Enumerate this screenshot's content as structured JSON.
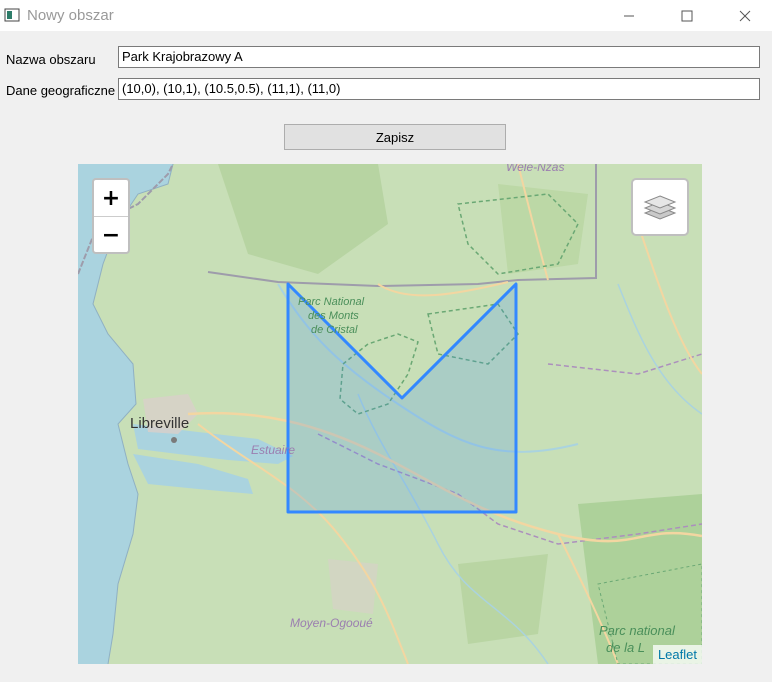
{
  "window": {
    "title": "Nowy obszar",
    "minimize_icon": "minimize-icon",
    "maximize_icon": "maximize-icon",
    "close_icon": "close-icon"
  },
  "form": {
    "name_label": "Nazwa obszaru",
    "name_value": "Park Krajobrazowy A",
    "geo_label": "Dane geograficzne",
    "geo_value": "(10,0), (10,1), (10.5,0.5), (11,1), (11,0)",
    "save_label": "Zapisz"
  },
  "map": {
    "zoom_in": "+",
    "zoom_out": "−",
    "layers_icon": "layers-icon",
    "attribution": "Leaflet",
    "labels": {
      "libreville": "Libreville",
      "estuaire": "Estuaire",
      "moyen_ogooue": "Moyen-Ogooué",
      "wele_nzas": "Wele-Nzas",
      "parc_monts_1": "Parc National",
      "parc_monts_2": "des Monts",
      "parc_monts_3": "de Cristal",
      "parc_national_1": "Parc national",
      "parc_national_2": "de la L"
    },
    "polygon_color": "#3388ff",
    "water_color": "#aad3df",
    "land_color": "#c8dfb7"
  }
}
